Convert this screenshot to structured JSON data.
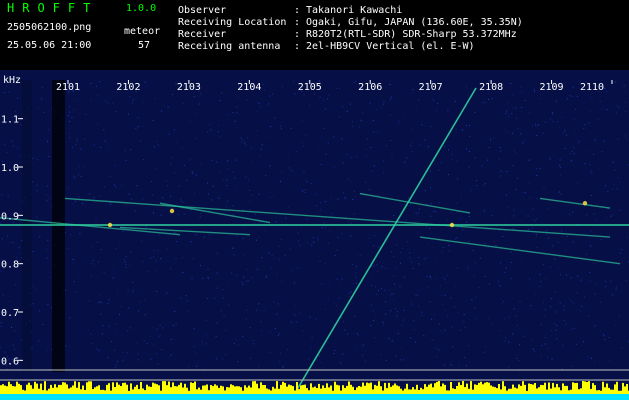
{
  "app": {
    "title": "HROFFT",
    "version": "1.0.0"
  },
  "capture": {
    "filename": "2505062100.png",
    "datetime": "25.05.06 21:00"
  },
  "meteor": {
    "label": "meteor",
    "count": "57"
  },
  "info": [
    {
      "key": "Observer",
      "value": "Takanori Kawachi"
    },
    {
      "key": "Receiving Location",
      "value": "Ogaki, Gifu, JAPAN (136.60E, 35.35N)"
    },
    {
      "key": "Receiver",
      "value": "R820T2(RTL-SDR) SDR-Sharp 53.372MHz"
    },
    {
      "key": "Receiving antenna",
      "value": "2el-HB9CV Vertical (el. E-W)"
    }
  ],
  "chart_data": {
    "type": "heatmap",
    "ylabel": "kHz",
    "x_ticks": [
      "2101",
      "2102",
      "2103",
      "2104",
      "2105",
      "2106",
      "2107",
      "2108",
      "2109",
      "2110"
    ],
    "y_ticks": [
      "1.1",
      "1.0",
      "0.9",
      "0.8",
      "0.7",
      "0.6"
    ],
    "ylim": [
      0.58,
      1.18
    ],
    "carrier_khz": 0.88,
    "colors": {
      "background": "#061046",
      "noise": "#2040c8",
      "trace": "#30d0a0",
      "hot": "#ffe040",
      "amplitude": "#ffff00",
      "baseline": "#00e0ff"
    }
  }
}
